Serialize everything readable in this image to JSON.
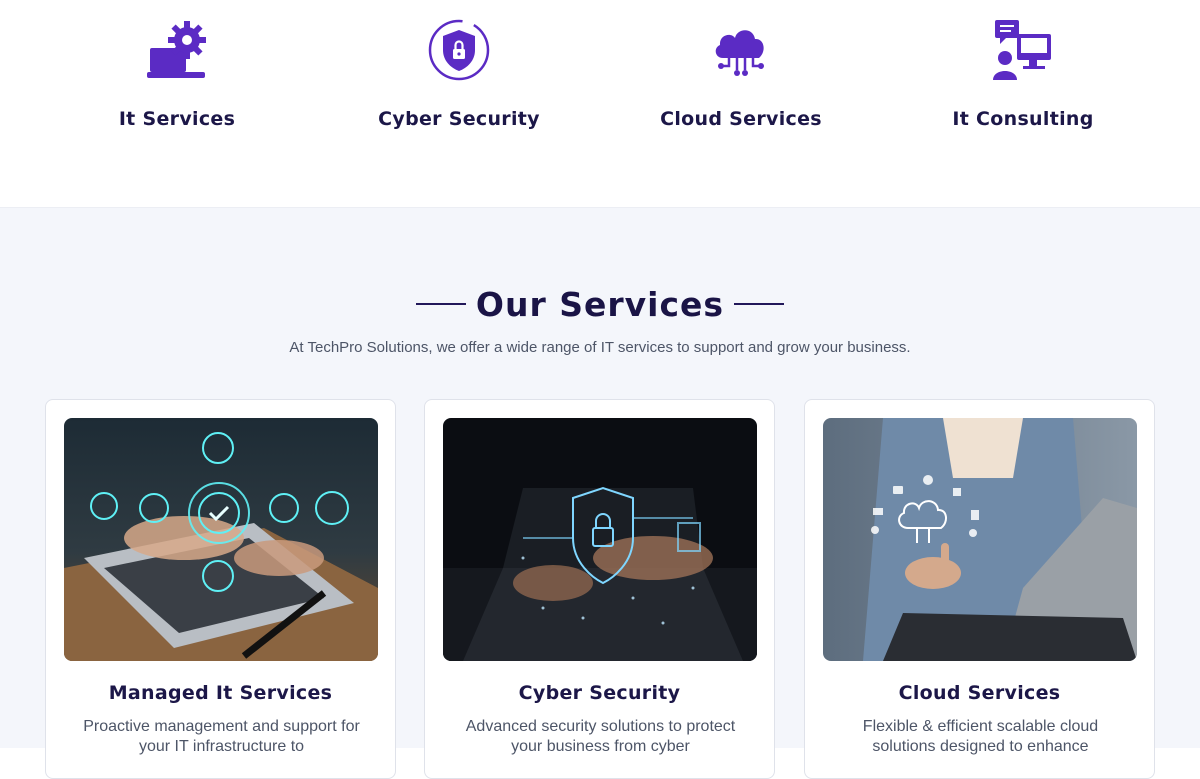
{
  "features": [
    {
      "title": "It Services",
      "icon": "laptop-gear-icon"
    },
    {
      "title": "Cyber Security",
      "icon": "shield-lock-icon"
    },
    {
      "title": "Cloud Services",
      "icon": "cloud-network-icon"
    },
    {
      "title": "It Consulting",
      "icon": "consultant-monitor-icon"
    }
  ],
  "services": {
    "heading": "Our Services",
    "subtitle": "At TechPro Solutions, we offer a wide range of IT services to support and grow your business.",
    "cards": [
      {
        "title": "Managed It Services",
        "description": "Proactive management and support for your IT infrastructure to",
        "image": "hands-typing-laptop-with-icons-image"
      },
      {
        "title": "Cyber Security",
        "description": "Advanced security solutions to protect your business from cyber",
        "image": "laptop-shield-lock-image"
      },
      {
        "title": "Cloud Services",
        "description": "Flexible & efficient scalable cloud solutions designed to enhance",
        "image": "man-touching-cloud-icon-image"
      }
    ]
  },
  "colors": {
    "accent": "#5b2bc4",
    "heading": "#1a1446",
    "section_bg": "#f4f6fb"
  }
}
